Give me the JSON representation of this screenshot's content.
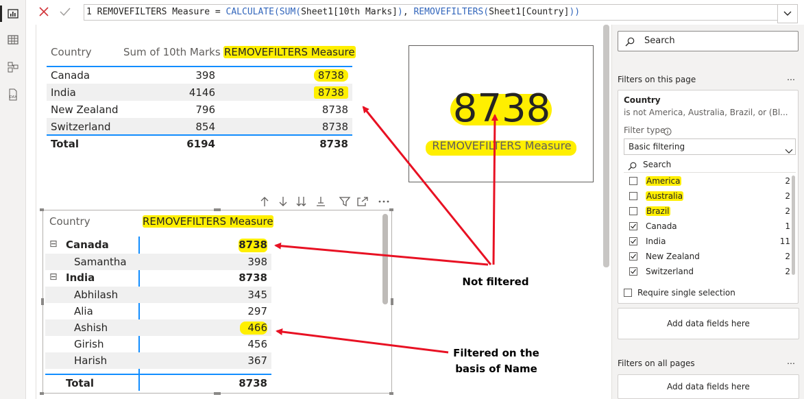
{
  "formula": {
    "line": "1",
    "measure_name": "REMOVEFILTERS Measure",
    "op": "=",
    "func1": "CALCULATE",
    "func2": "SUM",
    "arg1": "Sheet1[10th Marks]",
    "func3": "REMOVEFILTERS",
    "arg2": "Sheet1[Country]"
  },
  "table1": {
    "headers": [
      "Country",
      "Sum of 10th Marks",
      "REMOVEFILTERS Measure"
    ],
    "rows": [
      {
        "country": "Canada",
        "sum": "398",
        "measure": "8738"
      },
      {
        "country": "India",
        "sum": "4146",
        "measure": "8738"
      },
      {
        "country": "New Zealand",
        "sum": "796",
        "measure": "8738"
      },
      {
        "country": "Switzerland",
        "sum": "854",
        "measure": "8738"
      }
    ],
    "total": {
      "label": "Total",
      "sum": "6194",
      "measure": "8738"
    }
  },
  "card": {
    "value": "8738",
    "label": "REMOVEFILTERS Measure"
  },
  "matrix": {
    "headers": [
      "Country",
      "REMOVEFILTERS Measure"
    ],
    "rows": [
      {
        "label": "Canada",
        "value": "8738",
        "level": 0
      },
      {
        "label": "Samantha",
        "value": "398",
        "level": 1
      },
      {
        "label": "India",
        "value": "8738",
        "level": 0
      },
      {
        "label": "Abhilash",
        "value": "345",
        "level": 1
      },
      {
        "label": "Alia",
        "value": "297",
        "level": 1
      },
      {
        "label": "Ashish",
        "value": "466",
        "level": 1
      },
      {
        "label": "Girish",
        "value": "456",
        "level": 1
      },
      {
        "label": "Harish",
        "value": "367",
        "level": 1
      }
    ],
    "total": {
      "label": "Total",
      "value": "8738"
    },
    "expand_symbol": "⊟"
  },
  "annotations": {
    "not_filtered": "Not filtered",
    "filtered_line1": "Filtered on the",
    "filtered_line2": "basis of Name"
  },
  "filters_pane": {
    "search_placeholder": "Search",
    "section_this_page": "Filters on this page",
    "card_field": "Country",
    "card_summary": "is not America, Australia, Brazil, or (Bl...",
    "filter_type_label": "Filter type",
    "filter_type_value": "Basic filtering",
    "list_search": "Search",
    "items": [
      {
        "label": "America",
        "count": "2",
        "checked": false
      },
      {
        "label": "Australia",
        "count": "2",
        "checked": false
      },
      {
        "label": "Brazil",
        "count": "2",
        "checked": false
      },
      {
        "label": "Canada",
        "count": "1",
        "checked": true
      },
      {
        "label": "India",
        "count": "11",
        "checked": true
      },
      {
        "label": "New Zealand",
        "count": "2",
        "checked": true
      },
      {
        "label": "Switzerland",
        "count": "2",
        "checked": true
      }
    ],
    "require_single": "Require single selection",
    "add_fields": "Add data fields here",
    "section_all_pages": "Filters on all pages",
    "add_fields_2": "Add data fields here",
    "more": "…"
  },
  "colors": {
    "highlight": "#ffef00",
    "arrow": "#e81123",
    "accent": "#118dff"
  }
}
